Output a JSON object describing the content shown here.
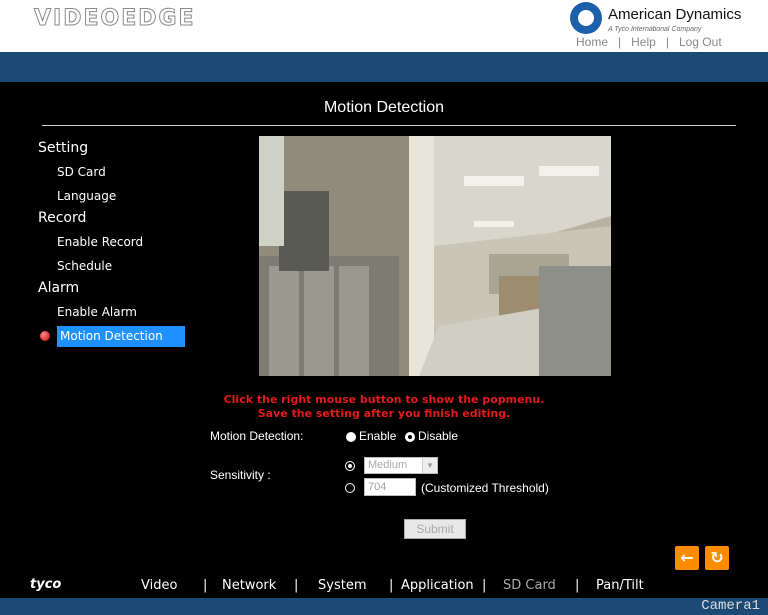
{
  "header": {
    "logo": "VIDEOEDGE",
    "brand_name": "American Dynamics",
    "brand_sub": "A Tyco International Company",
    "links": [
      "Home",
      "Help",
      "Log Out"
    ],
    "separator": "|"
  },
  "page": {
    "title": "Motion Detection"
  },
  "sidebar": {
    "setting": "Setting",
    "sd_card": "SD Card",
    "language": "Language",
    "record": "Record",
    "enable_record": "Enable Record",
    "schedule": "Schedule",
    "alarm": "Alarm",
    "enable_alarm": "Enable Alarm",
    "motion_detection": "Motion Detection"
  },
  "hint": {
    "line1": "Click the right mouse button to show the popmenu.",
    "line2": "Save the setting after you finish editing."
  },
  "form": {
    "motion_label": "Motion Detection:",
    "enable_label": "Enable",
    "disable_label": "Disable",
    "motion_value": "Disable",
    "sensitivity_label": "Sensitivity :",
    "sensitivity_select": "Medium",
    "threshold_value": "704",
    "threshold_label": "(Customized Threshold)",
    "submit_label": "Submit"
  },
  "controls": {
    "back_icon": "←",
    "refresh_icon": "↻"
  },
  "bottom_nav": {
    "brand": "tyco",
    "items": [
      "Video",
      "Network",
      "System",
      "Application",
      "SD Card",
      "Pan/Tilt"
    ],
    "separator": "|"
  },
  "status": {
    "camera": "Camera1"
  },
  "colors": {
    "header_blue": "#1b4a75",
    "active_blue": "#1e90ff",
    "hint_red": "#e31b1b",
    "button_orange": "#ff8c00"
  }
}
